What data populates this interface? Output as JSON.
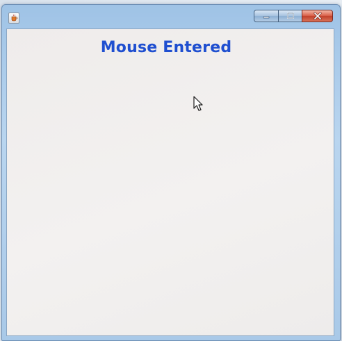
{
  "window": {
    "app_icon": "java-coffee-cup-icon",
    "controls": {
      "minimize_icon": "minimize-icon",
      "maximize_icon": "maximize-icon",
      "close_icon": "close-icon",
      "close_color": "#c94a35"
    }
  },
  "content": {
    "status_text": "Mouse Entered",
    "status_color": "#1f4fd0"
  },
  "cursor": {
    "icon": "arrow-cursor-icon"
  }
}
